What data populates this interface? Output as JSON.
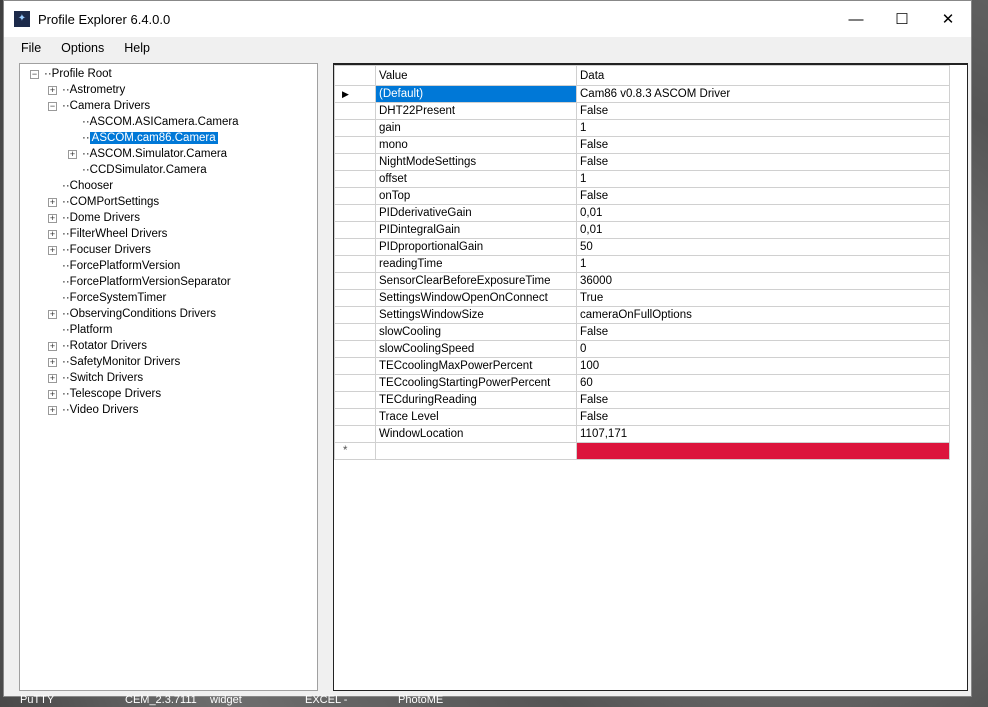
{
  "window": {
    "title": "Profile Explorer 6.4.0.0",
    "minimize": "—",
    "maximize": "☐",
    "close": "✕"
  },
  "menu": [
    "File",
    "Options",
    "Help"
  ],
  "tree": [
    {
      "label": "Profile Root",
      "level": 0,
      "exp": "-"
    },
    {
      "label": "Astrometry",
      "level": 1,
      "exp": "+"
    },
    {
      "label": "Camera Drivers",
      "level": 1,
      "exp": "-"
    },
    {
      "label": "ASCOM.ASICamera.Camera",
      "level": 2,
      "exp": ""
    },
    {
      "label": "ASCOM.cam86.Camera",
      "level": 2,
      "exp": "",
      "selected": true
    },
    {
      "label": "ASCOM.Simulator.Camera",
      "level": 2,
      "exp": "+"
    },
    {
      "label": "CCDSimulator.Camera",
      "level": 2,
      "exp": ""
    },
    {
      "label": "Chooser",
      "level": 1,
      "exp": ""
    },
    {
      "label": "COMPortSettings",
      "level": 1,
      "exp": "+"
    },
    {
      "label": "Dome Drivers",
      "level": 1,
      "exp": "+"
    },
    {
      "label": "FilterWheel Drivers",
      "level": 1,
      "exp": "+"
    },
    {
      "label": "Focuser Drivers",
      "level": 1,
      "exp": "+"
    },
    {
      "label": "ForcePlatformVersion",
      "level": 1,
      "exp": ""
    },
    {
      "label": "ForcePlatformVersionSeparator",
      "level": 1,
      "exp": ""
    },
    {
      "label": "ForceSystemTimer",
      "level": 1,
      "exp": ""
    },
    {
      "label": "ObservingConditions Drivers",
      "level": 1,
      "exp": "+"
    },
    {
      "label": "Platform",
      "level": 1,
      "exp": ""
    },
    {
      "label": "Rotator Drivers",
      "level": 1,
      "exp": "+"
    },
    {
      "label": "SafetyMonitor Drivers",
      "level": 1,
      "exp": "+"
    },
    {
      "label": "Switch Drivers",
      "level": 1,
      "exp": "+"
    },
    {
      "label": "Telescope Drivers",
      "level": 1,
      "exp": "+"
    },
    {
      "label": "Video Drivers",
      "level": 1,
      "exp": "+"
    }
  ],
  "grid": {
    "headers": [
      "Value",
      "Data"
    ],
    "rows": [
      [
        "(Default)",
        "Cam86 v0.8.3 ASCOM Driver"
      ],
      [
        "DHT22Present",
        "False"
      ],
      [
        "gain",
        "1"
      ],
      [
        "mono",
        "False"
      ],
      [
        "NightModeSettings",
        "False"
      ],
      [
        "offset",
        "1"
      ],
      [
        "onTop",
        "False"
      ],
      [
        "PIDderivativeGain",
        "0,01"
      ],
      [
        "PIDintegralGain",
        "0,01"
      ],
      [
        "PIDproportionalGain",
        "50"
      ],
      [
        "readingTime",
        "1"
      ],
      [
        "SensorClearBeforeExposureTime",
        "36000"
      ],
      [
        "SettingsWindowOpenOnConnect",
        "True"
      ],
      [
        "SettingsWindowSize",
        "cameraOnFullOptions"
      ],
      [
        "slowCooling",
        "False"
      ],
      [
        "slowCoolingSpeed",
        "0"
      ],
      [
        "TECcoolingMaxPowerPercent",
        "100"
      ],
      [
        "TECcoolingStartingPowerPercent",
        "60"
      ],
      [
        "TECduringReading",
        "False"
      ],
      [
        "Trace Level",
        "False"
      ],
      [
        "WindowLocation",
        "1107,171"
      ]
    ],
    "current_marker": "▶",
    "new_marker": "*",
    "new_row_color": "#dc143c",
    "selection_color": "#0078d7"
  },
  "desktop_icons": [
    "PuTTY",
    "CEM_2.3.7111",
    "widget",
    "EXCEL -",
    "PhotoME"
  ]
}
